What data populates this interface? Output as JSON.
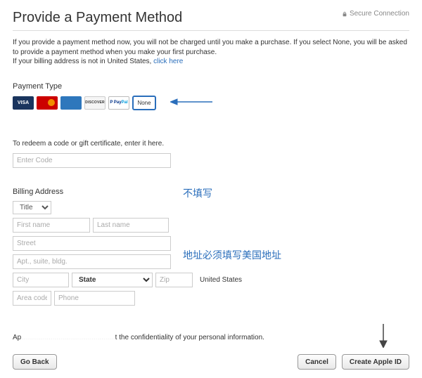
{
  "header": {
    "title": "Provide a Payment Method",
    "secure": "Secure Connection"
  },
  "intro": {
    "line1": "If you provide a payment method now, you will not be charged until you make a purchase. If you select None, you will be asked to provide a payment method when you make your first purchase.",
    "line2a": "If your billing address is not in United States, ",
    "link": "click here"
  },
  "payment": {
    "label": "Payment Type",
    "cards": {
      "visa": "VISA",
      "mc": "",
      "amex": "",
      "disc": "DISCOVER",
      "paypal_a": "Pay",
      "paypal_b": "Pal",
      "none": "None"
    }
  },
  "redeem": {
    "hint": "To redeem a code or gift certificate, enter it here.",
    "placeholder": "Enter Code"
  },
  "annotations": {
    "dont_fill": "不填写",
    "us_address": "地址必须填写美国地址"
  },
  "billing": {
    "label": "Billing Address",
    "title_option": "Title",
    "first_name_ph": "First name",
    "last_name_ph": "Last name",
    "street_ph": "Street",
    "apt_ph": "Apt., suite, bldg.",
    "city_ph": "City",
    "state_option": "State",
    "zip_ph": "Zip",
    "country": "United States",
    "area_ph": "Area code",
    "phone_ph": "Phone"
  },
  "footnote": {
    "prefix": "Ap",
    "visible": "t the confidentiality of your personal information."
  },
  "buttons": {
    "go_back": "Go Back",
    "cancel": "Cancel",
    "create": "Create Apple ID"
  }
}
